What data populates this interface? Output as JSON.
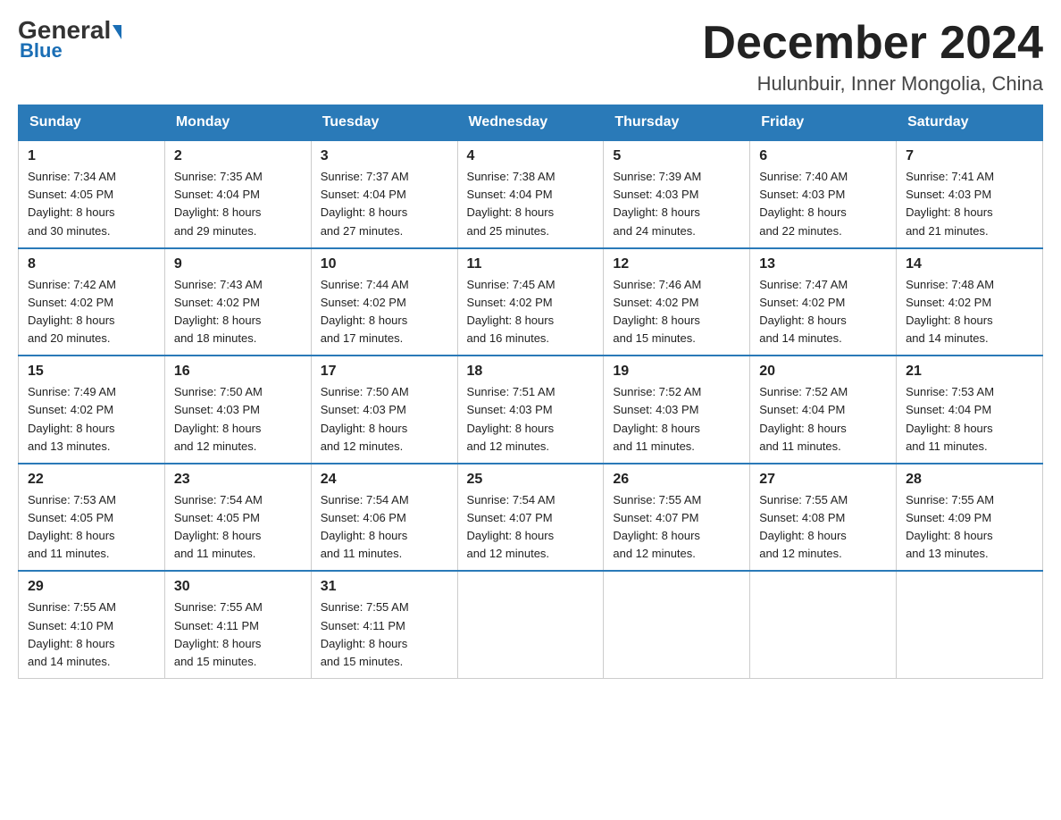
{
  "logo": {
    "general": "General",
    "blue": "Blue"
  },
  "header": {
    "month_title": "December 2024",
    "subtitle": "Hulunbuir, Inner Mongolia, China"
  },
  "weekdays": [
    "Sunday",
    "Monday",
    "Tuesday",
    "Wednesday",
    "Thursday",
    "Friday",
    "Saturday"
  ],
  "weeks": [
    [
      {
        "day": "1",
        "info": "Sunrise: 7:34 AM\nSunset: 4:05 PM\nDaylight: 8 hours\nand 30 minutes."
      },
      {
        "day": "2",
        "info": "Sunrise: 7:35 AM\nSunset: 4:04 PM\nDaylight: 8 hours\nand 29 minutes."
      },
      {
        "day": "3",
        "info": "Sunrise: 7:37 AM\nSunset: 4:04 PM\nDaylight: 8 hours\nand 27 minutes."
      },
      {
        "day": "4",
        "info": "Sunrise: 7:38 AM\nSunset: 4:04 PM\nDaylight: 8 hours\nand 25 minutes."
      },
      {
        "day": "5",
        "info": "Sunrise: 7:39 AM\nSunset: 4:03 PM\nDaylight: 8 hours\nand 24 minutes."
      },
      {
        "day": "6",
        "info": "Sunrise: 7:40 AM\nSunset: 4:03 PM\nDaylight: 8 hours\nand 22 minutes."
      },
      {
        "day": "7",
        "info": "Sunrise: 7:41 AM\nSunset: 4:03 PM\nDaylight: 8 hours\nand 21 minutes."
      }
    ],
    [
      {
        "day": "8",
        "info": "Sunrise: 7:42 AM\nSunset: 4:02 PM\nDaylight: 8 hours\nand 20 minutes."
      },
      {
        "day": "9",
        "info": "Sunrise: 7:43 AM\nSunset: 4:02 PM\nDaylight: 8 hours\nand 18 minutes."
      },
      {
        "day": "10",
        "info": "Sunrise: 7:44 AM\nSunset: 4:02 PM\nDaylight: 8 hours\nand 17 minutes."
      },
      {
        "day": "11",
        "info": "Sunrise: 7:45 AM\nSunset: 4:02 PM\nDaylight: 8 hours\nand 16 minutes."
      },
      {
        "day": "12",
        "info": "Sunrise: 7:46 AM\nSunset: 4:02 PM\nDaylight: 8 hours\nand 15 minutes."
      },
      {
        "day": "13",
        "info": "Sunrise: 7:47 AM\nSunset: 4:02 PM\nDaylight: 8 hours\nand 14 minutes."
      },
      {
        "day": "14",
        "info": "Sunrise: 7:48 AM\nSunset: 4:02 PM\nDaylight: 8 hours\nand 14 minutes."
      }
    ],
    [
      {
        "day": "15",
        "info": "Sunrise: 7:49 AM\nSunset: 4:02 PM\nDaylight: 8 hours\nand 13 minutes."
      },
      {
        "day": "16",
        "info": "Sunrise: 7:50 AM\nSunset: 4:03 PM\nDaylight: 8 hours\nand 12 minutes."
      },
      {
        "day": "17",
        "info": "Sunrise: 7:50 AM\nSunset: 4:03 PM\nDaylight: 8 hours\nand 12 minutes."
      },
      {
        "day": "18",
        "info": "Sunrise: 7:51 AM\nSunset: 4:03 PM\nDaylight: 8 hours\nand 12 minutes."
      },
      {
        "day": "19",
        "info": "Sunrise: 7:52 AM\nSunset: 4:03 PM\nDaylight: 8 hours\nand 11 minutes."
      },
      {
        "day": "20",
        "info": "Sunrise: 7:52 AM\nSunset: 4:04 PM\nDaylight: 8 hours\nand 11 minutes."
      },
      {
        "day": "21",
        "info": "Sunrise: 7:53 AM\nSunset: 4:04 PM\nDaylight: 8 hours\nand 11 minutes."
      }
    ],
    [
      {
        "day": "22",
        "info": "Sunrise: 7:53 AM\nSunset: 4:05 PM\nDaylight: 8 hours\nand 11 minutes."
      },
      {
        "day": "23",
        "info": "Sunrise: 7:54 AM\nSunset: 4:05 PM\nDaylight: 8 hours\nand 11 minutes."
      },
      {
        "day": "24",
        "info": "Sunrise: 7:54 AM\nSunset: 4:06 PM\nDaylight: 8 hours\nand 11 minutes."
      },
      {
        "day": "25",
        "info": "Sunrise: 7:54 AM\nSunset: 4:07 PM\nDaylight: 8 hours\nand 12 minutes."
      },
      {
        "day": "26",
        "info": "Sunrise: 7:55 AM\nSunset: 4:07 PM\nDaylight: 8 hours\nand 12 minutes."
      },
      {
        "day": "27",
        "info": "Sunrise: 7:55 AM\nSunset: 4:08 PM\nDaylight: 8 hours\nand 12 minutes."
      },
      {
        "day": "28",
        "info": "Sunrise: 7:55 AM\nSunset: 4:09 PM\nDaylight: 8 hours\nand 13 minutes."
      }
    ],
    [
      {
        "day": "29",
        "info": "Sunrise: 7:55 AM\nSunset: 4:10 PM\nDaylight: 8 hours\nand 14 minutes."
      },
      {
        "day": "30",
        "info": "Sunrise: 7:55 AM\nSunset: 4:11 PM\nDaylight: 8 hours\nand 15 minutes."
      },
      {
        "day": "31",
        "info": "Sunrise: 7:55 AM\nSunset: 4:11 PM\nDaylight: 8 hours\nand 15 minutes."
      },
      null,
      null,
      null,
      null
    ]
  ]
}
